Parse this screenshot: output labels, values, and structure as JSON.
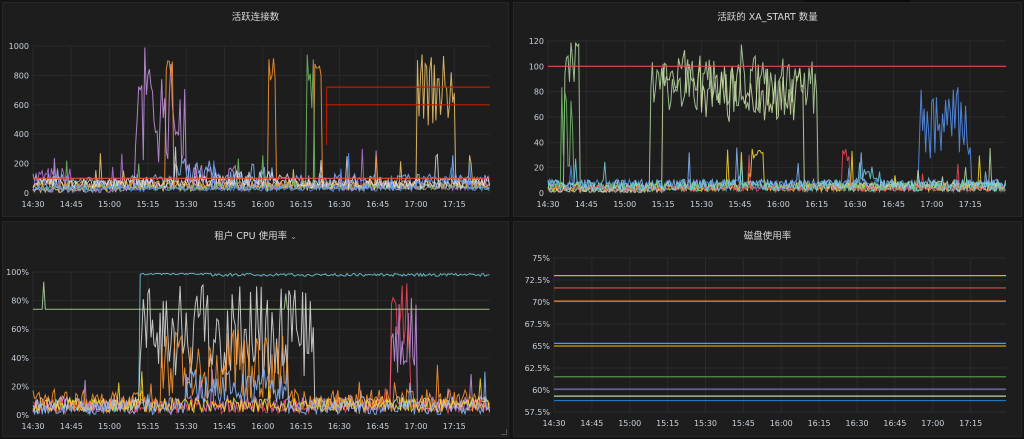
{
  "time_ticks": [
    "14:30",
    "14:45",
    "15:00",
    "15:15",
    "15:30",
    "15:45",
    "16:00",
    "16:15",
    "16:30",
    "16:45",
    "17:00",
    "17:15"
  ],
  "panels": [
    {
      "title": "活跃连接数",
      "chart_data": {
        "type": "line",
        "x": [
          "14:30",
          "14:45",
          "15:00",
          "15:15",
          "15:30",
          "15:45",
          "16:00",
          "16:15",
          "16:30",
          "16:45",
          "17:00",
          "17:15"
        ],
        "xlim": [
          "14:30",
          "17:29"
        ],
        "ylim": [
          0,
          1000
        ],
        "yticks": [
          0,
          200,
          400,
          600,
          800,
          1000
        ],
        "ytick_labels": [
          "0",
          "200",
          "400",
          "600",
          "800",
          "1000"
        ],
        "threshold_lines": [
          {
            "y": 100,
            "color": "#e24d42"
          },
          {
            "y": 600,
            "color": "#bf1b00",
            "from": "16:25"
          },
          {
            "y": 720,
            "color": "#bf1b00",
            "from": "16:25"
          }
        ],
        "series_colors": [
          "#b877d9",
          "#ca95e5",
          "#f2c96d",
          "#ff9830",
          "#8ab8ff",
          "#73bf69",
          "#e0e0e0",
          "#5794f2"
        ]
      }
    },
    {
      "title": "活跃的 XA_START 数量",
      "chart_data": {
        "type": "line",
        "x": [
          "14:30",
          "14:45",
          "15:00",
          "15:15",
          "15:30",
          "15:45",
          "16:00",
          "16:15",
          "16:30",
          "16:45",
          "17:00",
          "17:15"
        ],
        "xlim": [
          "14:30",
          "17:29"
        ],
        "ylim": [
          0,
          120
        ],
        "yticks": [
          0,
          20,
          40,
          60,
          80,
          100,
          120
        ],
        "ytick_labels": [
          "0",
          "20",
          "40",
          "60",
          "80",
          "100",
          "120"
        ],
        "threshold_lines": [
          {
            "y": 100,
            "color": "#e24d42"
          }
        ],
        "series_colors": [
          "#5794f2",
          "#b5d8a4",
          "#cfe1a3",
          "#fade2a",
          "#8ab8ff",
          "#73bf69",
          "#f2495c",
          "#6ed0e0"
        ]
      }
    },
    {
      "title": "租户 CPU 使用率",
      "title_caret": "⌄",
      "chart_data": {
        "type": "line",
        "x": [
          "14:30",
          "14:45",
          "15:00",
          "15:15",
          "15:30",
          "15:45",
          "16:00",
          "16:15",
          "16:30",
          "16:45",
          "17:00",
          "17:15"
        ],
        "xlim": [
          "14:30",
          "17:29"
        ],
        "ylim": [
          0,
          100
        ],
        "yticks": [
          0,
          20,
          40,
          60,
          80,
          100
        ],
        "ytick_labels": [
          "0%",
          "20%",
          "40%",
          "60%",
          "80%",
          "100%"
        ],
        "series_colors": [
          "#6ed0e0",
          "#e0e0e0",
          "#ca95e5",
          "#f2495c",
          "#ff9830",
          "#b5d8a4",
          "#fade2a",
          "#8ab8ff"
        ]
      }
    },
    {
      "title": "磁盘使用率",
      "chart_data": {
        "type": "line",
        "x": [
          "14:30",
          "14:45",
          "15:00",
          "15:15",
          "15:30",
          "15:45",
          "16:00",
          "16:15",
          "16:30",
          "16:45",
          "17:00",
          "17:15"
        ],
        "xlim": [
          "14:30",
          "17:29"
        ],
        "ylim": [
          57.5,
          75
        ],
        "yticks": [
          57.5,
          60,
          62.5,
          65,
          67.5,
          70,
          72.5,
          75
        ],
        "ytick_labels": [
          "57.5%",
          "60%",
          "62.5%",
          "65%",
          "67.5%",
          "70%",
          "72.5%",
          "75%"
        ],
        "series": [
          {
            "values": [
              73.0,
              73.0
            ],
            "color": "#e5ac0e"
          },
          {
            "values": [
              71.6,
              71.6
            ],
            "color": "#e24d42"
          },
          {
            "values": [
              70.1,
              70.1
            ],
            "color": "#ef843c"
          },
          {
            "values": [
              65.3,
              65.3
            ],
            "color": "#5794f2"
          },
          {
            "values": [
              65.0,
              65.0
            ],
            "color": "#cca300"
          },
          {
            "values": [
              61.5,
              61.5
            ],
            "color": "#629e51"
          },
          {
            "values": [
              60.1,
              60.1
            ],
            "color": "#806eb7"
          },
          {
            "values": [
              59.3,
              59.3
            ],
            "color": "#b5d8a4"
          },
          {
            "values": [
              58.8,
              58.8
            ],
            "color": "#1f78c1"
          }
        ]
      }
    }
  ]
}
